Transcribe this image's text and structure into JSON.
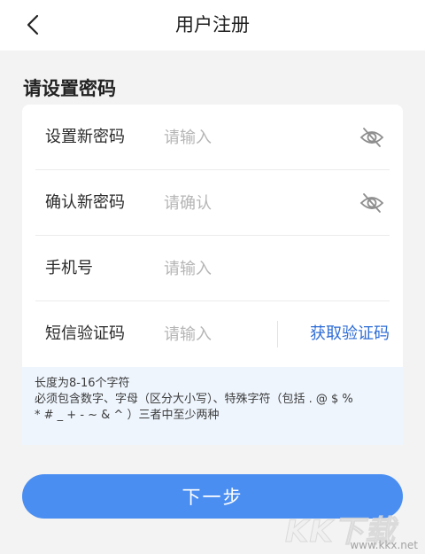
{
  "header": {
    "title": "用户注册",
    "back_icon": "chevron-left-icon"
  },
  "section": {
    "title": "请设置密码"
  },
  "form": {
    "new_password": {
      "label": "设置新密码",
      "placeholder": "请输入",
      "value": "",
      "icon": "eye-off-icon"
    },
    "confirm_password": {
      "label": "确认新密码",
      "placeholder": "请确认",
      "value": "",
      "icon": "eye-off-icon"
    },
    "phone": {
      "label": "手机号",
      "placeholder": "请输入",
      "value": ""
    },
    "sms_code": {
      "label": "短信验证码",
      "placeholder": "请输入",
      "value": "",
      "get_code_label": "获取验证码"
    }
  },
  "hint": {
    "line1": "长度为8-16个字符",
    "line2": "必须包含数字、字母（区分大小写）、特殊字符（包括 . @ $ %",
    "line3": "* # _ + - ~ & ^ ）三者中至少两种"
  },
  "next_button": {
    "label": "下一步"
  },
  "watermark": {
    "text": "KK下载",
    "url": "www.kkx.net"
  },
  "colors": {
    "accent": "#4a8ef2",
    "link": "#2f6dd6",
    "hint_bg": "#eef5fd",
    "page_bg": "#f3f3f3"
  }
}
